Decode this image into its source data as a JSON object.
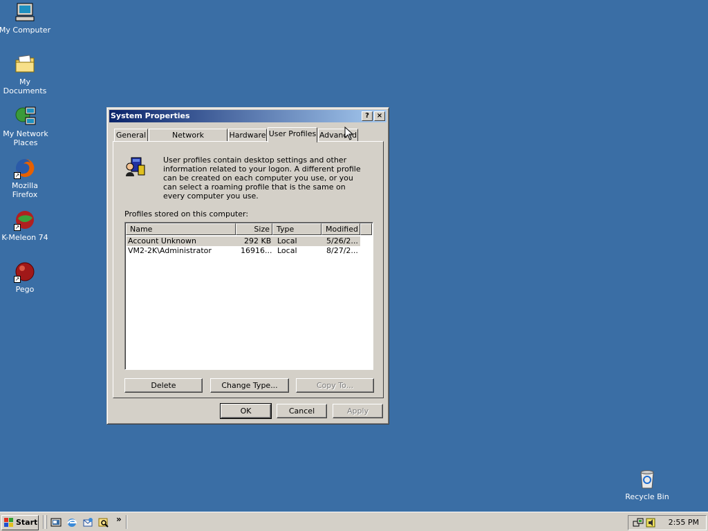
{
  "desktop": {
    "icons": [
      {
        "label": "My Computer",
        "icon": "my-computer-icon"
      },
      {
        "label": "My Documents",
        "icon": "my-documents-icon"
      },
      {
        "label": "My Network Places",
        "icon": "my-network-places-icon"
      },
      {
        "label": "Mozilla Firefox",
        "icon": "firefox-icon"
      },
      {
        "label": "K-Meleon 74",
        "icon": "k-meleon-icon"
      },
      {
        "label": "Pego",
        "icon": "pego-icon"
      },
      {
        "label": "Recycle Bin",
        "icon": "recycle-bin-icon"
      }
    ],
    "background_color": "#3a6ea5"
  },
  "window": {
    "title": "System Properties",
    "help_label": "?",
    "close_label": "×",
    "tabs": [
      {
        "label": "General"
      },
      {
        "label": "Network Identification"
      },
      {
        "label": "Hardware"
      },
      {
        "label": "User Profiles",
        "active": true
      },
      {
        "label": "Advanced"
      }
    ],
    "description": "User profiles contain desktop settings and other information related to your logon.  A different profile can be created on each computer you use, or you can select a roaming profile that is the same on every computer you use.",
    "profiles_label": "Profiles stored on this computer:",
    "list": {
      "columns": [
        "Name",
        "Size",
        "Type",
        "Modified"
      ],
      "rows": [
        {
          "name": "Account Unknown",
          "size": "292 KB",
          "type": "Local",
          "modified": "5/26/2...",
          "selected": true
        },
        {
          "name": "VM2-2K\\Administrator",
          "size": "16916...",
          "type": "Local",
          "modified": "8/27/2...",
          "selected": false
        }
      ]
    },
    "buttons": {
      "delete": "Delete",
      "change_type": "Change Type...",
      "copy_to": "Copy To...",
      "ok": "OK",
      "cancel": "Cancel",
      "apply": "Apply"
    }
  },
  "taskbar": {
    "start_label": "Start",
    "quick_launch_more": "»",
    "clock": "2:55 PM"
  }
}
